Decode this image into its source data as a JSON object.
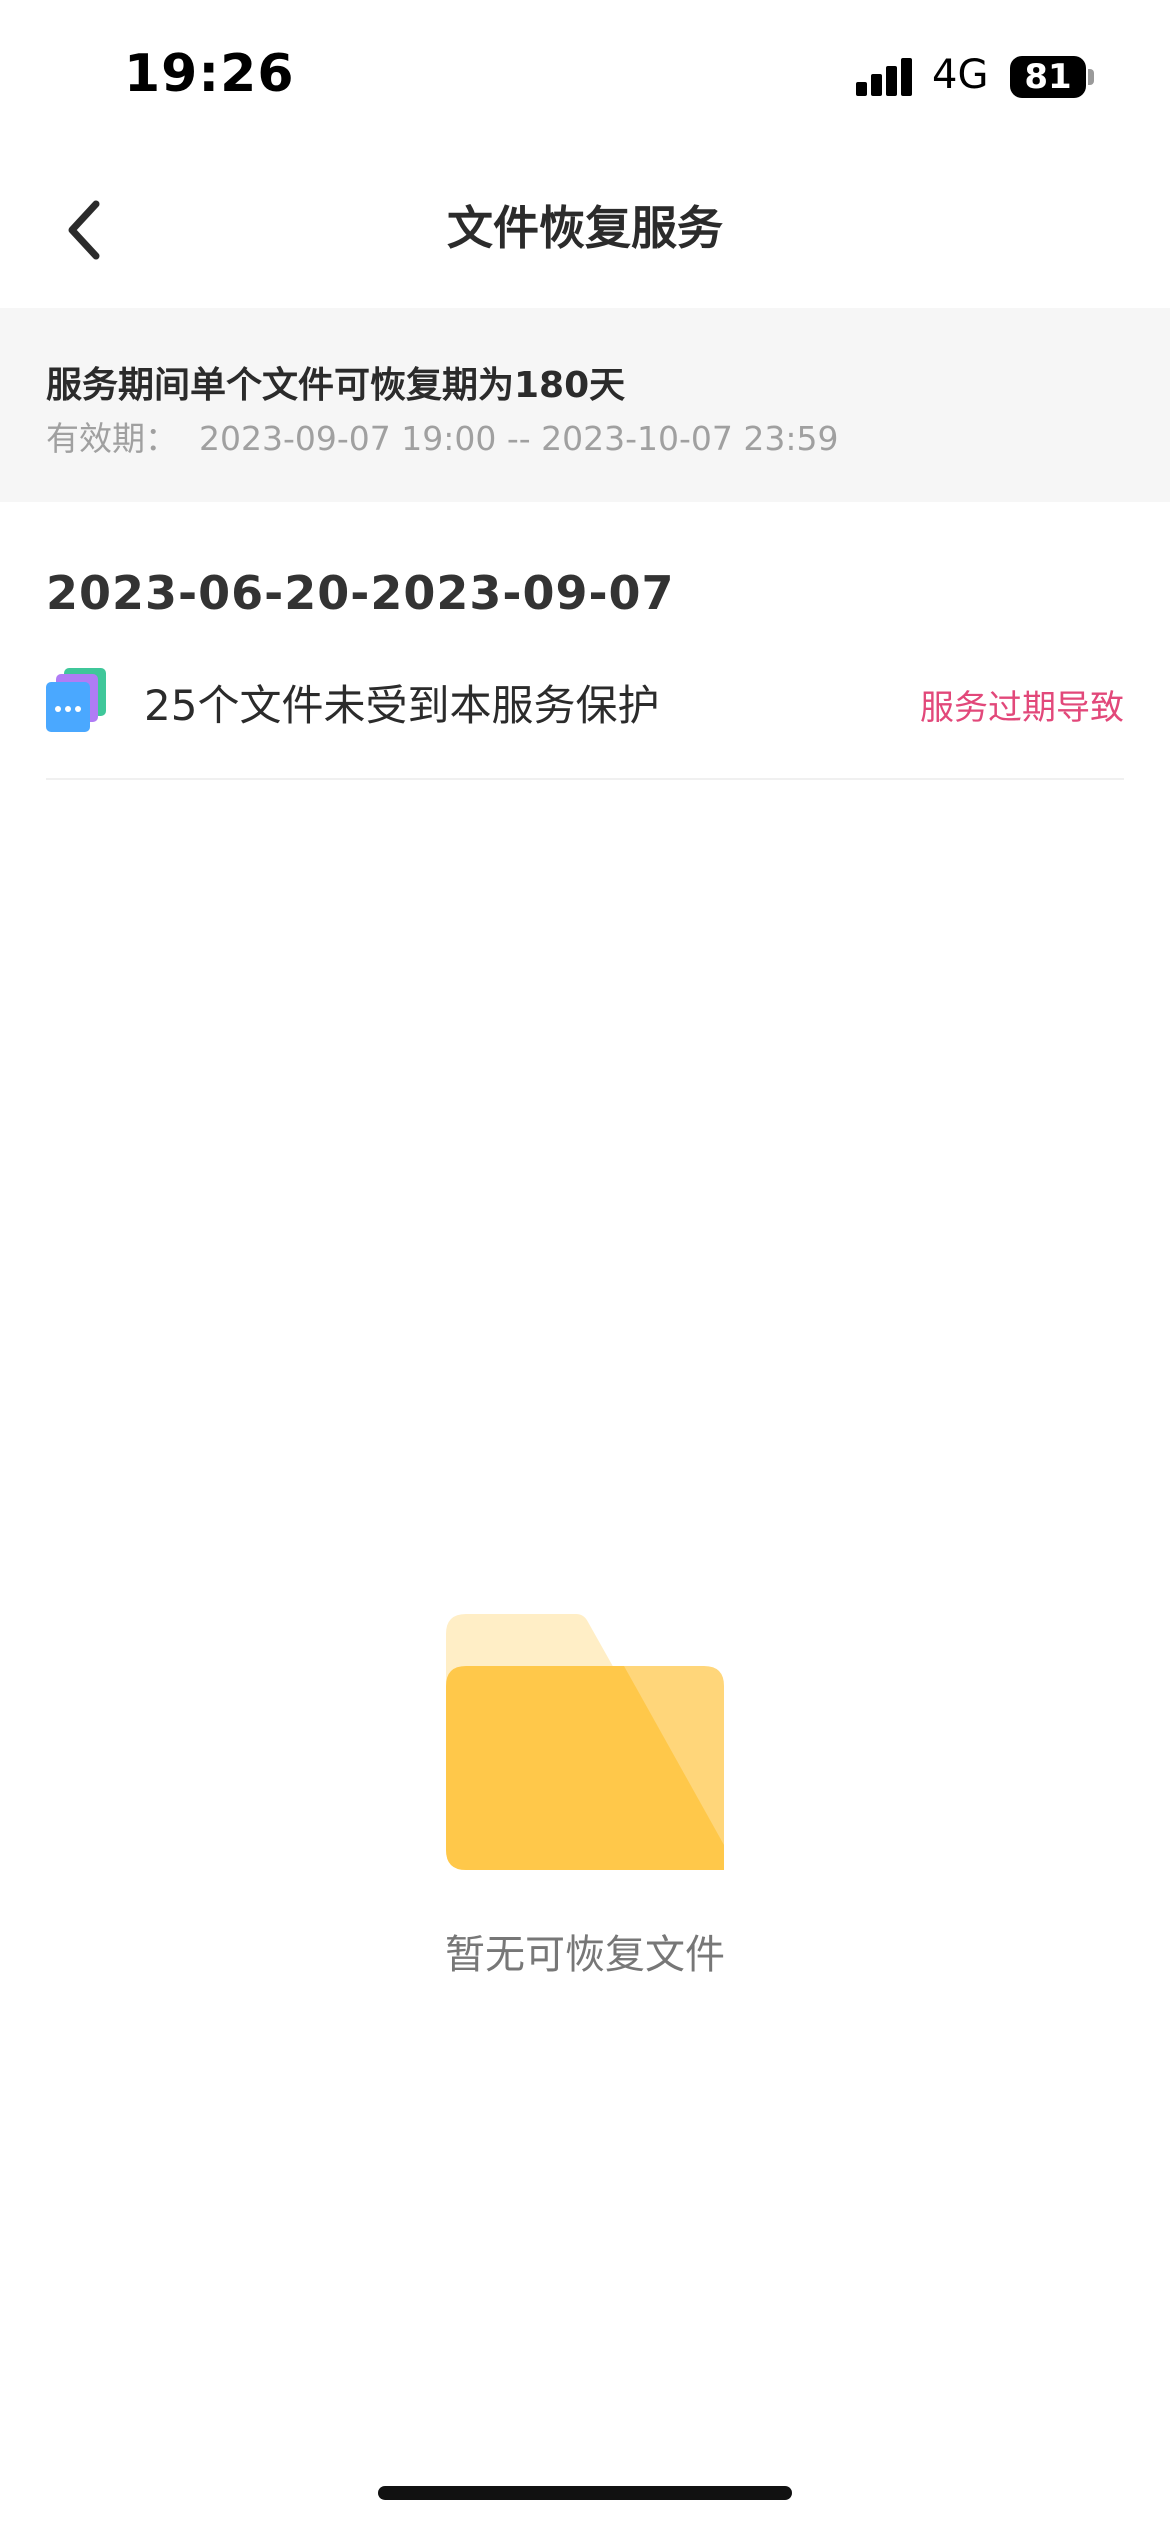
{
  "status_bar": {
    "time": "19:26",
    "network": "4G",
    "battery": "81"
  },
  "nav": {
    "back_icon": "chevron-left-icon",
    "title": "文件恢复服务"
  },
  "info_banner": {
    "title": "服务期间单个文件可恢复期为180天",
    "validity": "有效期：  2023-09-07 19:00 -- 2023-10-07 23:59"
  },
  "period": {
    "date_range": "2023-06-20-2023-09-07",
    "record": {
      "icon": "file-stack-icon",
      "text": "25个文件未受到本服务保护",
      "status": "服务过期导致"
    }
  },
  "empty_state": {
    "icon": "folder-icon",
    "text": "暂无可恢复文件"
  },
  "colors": {
    "accent_pink": "#e2487a",
    "folder_yellow": "#ffc84a",
    "banner_bg": "#f6f6f6"
  }
}
